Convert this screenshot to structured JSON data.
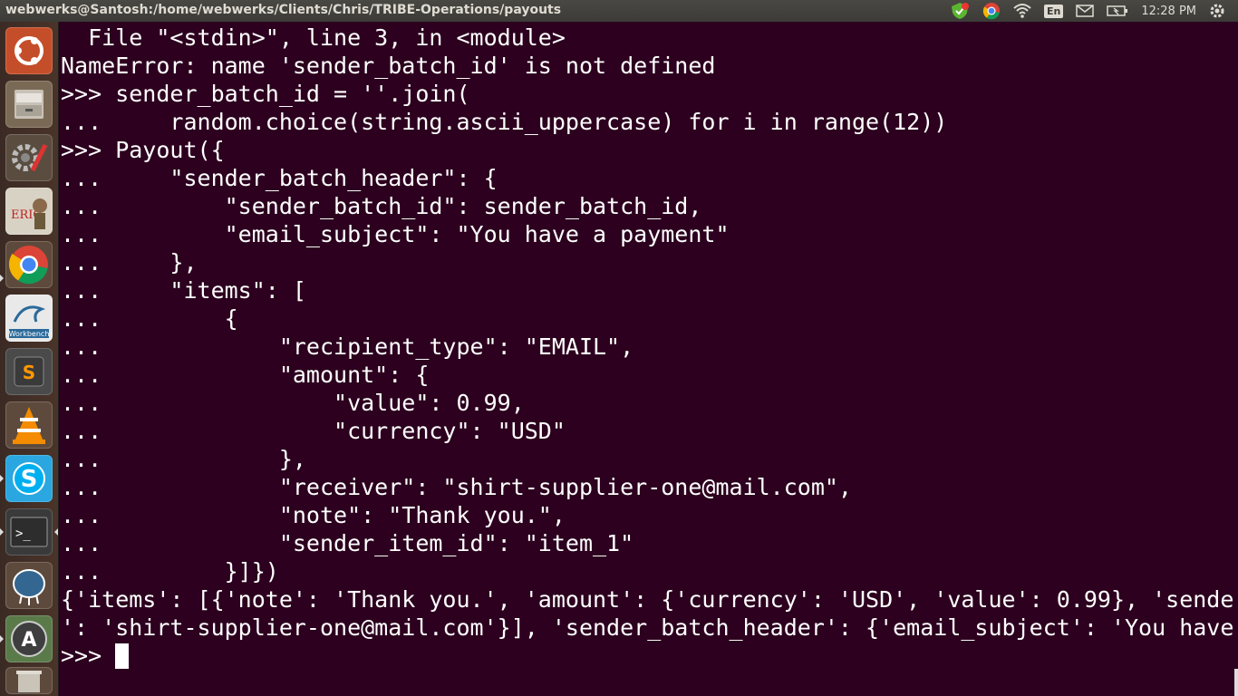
{
  "window": {
    "title": "webwerks@Santosh:/home/webwerks/Clients/Chris/TRIBE-Operations/payouts"
  },
  "indicators": {
    "keyboard_layout": "En",
    "clock": "12:28 PM",
    "icons": [
      "update-shield-icon",
      "chrome-tray-icon",
      "wifi-icon",
      "keyboard-icon",
      "mail-icon",
      "battery-icon"
    ]
  },
  "launcher": {
    "apps": [
      {
        "name": "ubuntu-dash-icon"
      },
      {
        "name": "files-icon"
      },
      {
        "name": "system-settings-icon"
      },
      {
        "name": "eric-ide-icon",
        "label": "ERIC"
      },
      {
        "name": "chrome-icon"
      },
      {
        "name": "mysql-workbench-icon",
        "label": "Workbench"
      },
      {
        "name": "sublime-text-icon",
        "label": "S"
      },
      {
        "name": "vlc-icon"
      },
      {
        "name": "skype-icon",
        "label": "S"
      },
      {
        "name": "terminal-icon",
        "label": ">_"
      },
      {
        "name": "pgadmin-icon"
      },
      {
        "name": "software-updater-icon",
        "label": "A"
      },
      {
        "name": "trash-icon"
      }
    ]
  },
  "terminal": {
    "lines": [
      "  File \"<stdin>\", line 3, in <module>",
      "NameError: name 'sender_batch_id' is not defined",
      ">>> sender_batch_id = ''.join(",
      "...     random.choice(string.ascii_uppercase) for i in range(12))",
      ">>> Payout({",
      "...     \"sender_batch_header\": {",
      "...         \"sender_batch_id\": sender_batch_id,",
      "...         \"email_subject\": \"You have a payment\"",
      "...     },",
      "...     \"items\": [",
      "...         {",
      "...             \"recipient_type\": \"EMAIL\",",
      "...             \"amount\": {",
      "...                 \"value\": 0.99,",
      "...                 \"currency\": \"USD\"",
      "...             },",
      "...             \"receiver\": \"shirt-supplier-one@mail.com\",",
      "...             \"note\": \"Thank you.\",",
      "...             \"sender_item_id\": \"item_1\"",
      "...         }]})",
      "{'items': [{'note': 'Thank you.', 'amount': {'currency': 'USD', 'value': 0.99}, 'sende",
      "': 'shirt-supplier-one@mail.com'}], 'sender_batch_header': {'email_subject': 'You have"
    ],
    "prompt": ">>> "
  }
}
